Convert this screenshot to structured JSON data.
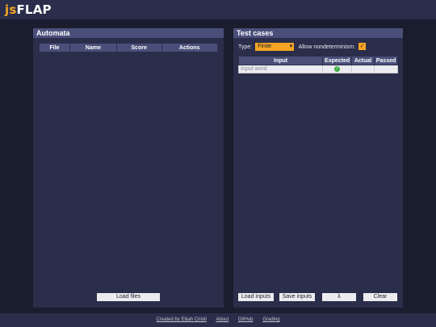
{
  "app": {
    "logo_js": "js",
    "logo_flap": "FLAP"
  },
  "automata": {
    "title": "Automata",
    "columns": [
      "File",
      "Name",
      "Score",
      "Actions"
    ],
    "load_button": "Load files"
  },
  "tests": {
    "title": "Test cases",
    "type_label": "Type:",
    "type_value": "Finite",
    "nondeterminism_label": "Allow nondeterminism:",
    "nondeterminism_checked": true,
    "columns": [
      "Input",
      "Expected",
      "Actual",
      "Passed"
    ],
    "input_placeholder": "Input word",
    "buttons": {
      "load": "Load inputs",
      "save": "Save inputs",
      "lambda": "λ",
      "clear": "Clear"
    }
  },
  "footer": {
    "links": [
      "Created by Elijah Cirioli",
      "About",
      "GitHub",
      "Grading"
    ]
  },
  "colors": {
    "accent": "#f5a524",
    "panel": "#2b2e4a",
    "header": "#4a4f7a",
    "success": "#3cb043"
  }
}
